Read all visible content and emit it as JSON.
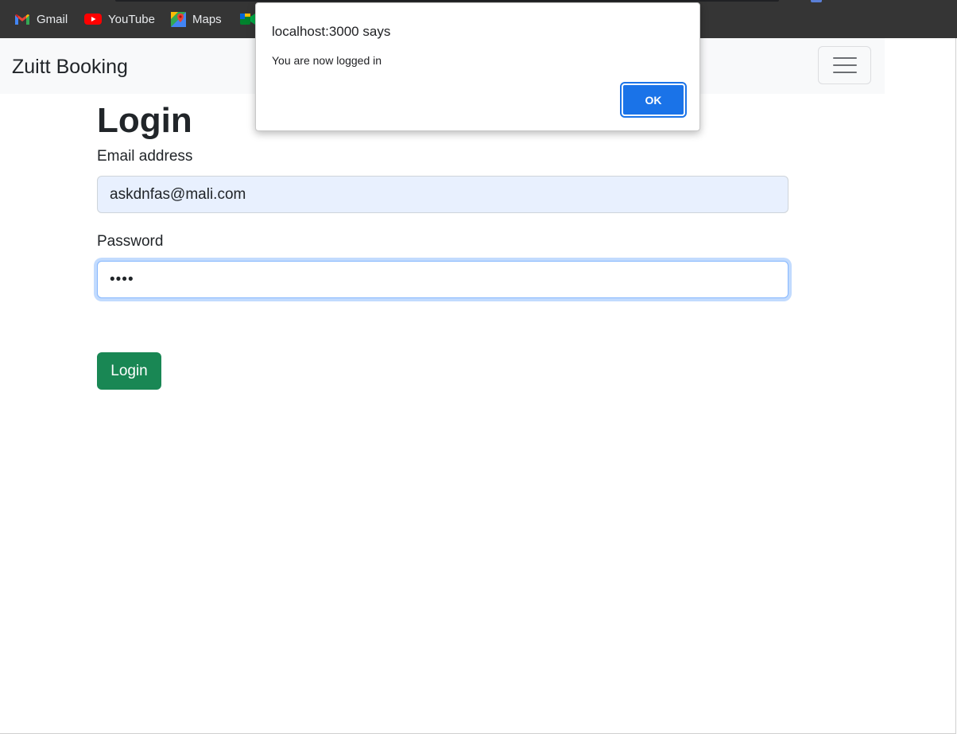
{
  "bookmarks": [
    {
      "label": "Gmail",
      "icon": "gmail-icon"
    },
    {
      "label": "YouTube",
      "icon": "youtube-icon"
    },
    {
      "label": "Maps",
      "icon": "maps-icon"
    }
  ],
  "navbar": {
    "brand": "Zuitt Booking",
    "toggler_icon": "hamburger-menu-icon"
  },
  "login_form": {
    "title": "Login",
    "email_label": "Email address",
    "email_value": "askdnfas@mali.com",
    "password_label": "Password",
    "password_value": "••••",
    "submit_label": "Login"
  },
  "alert": {
    "title": "localhost:3000 says",
    "message": "You are now logged in",
    "ok_label": "OK"
  },
  "colors": {
    "browser_bar": "#353535",
    "navbar_bg": "#f8f9fa",
    "autofill_bg": "#e8f0fe",
    "focus_border": "#86b7fe",
    "success_button": "#198754",
    "dialog_button": "#1a73e8"
  }
}
